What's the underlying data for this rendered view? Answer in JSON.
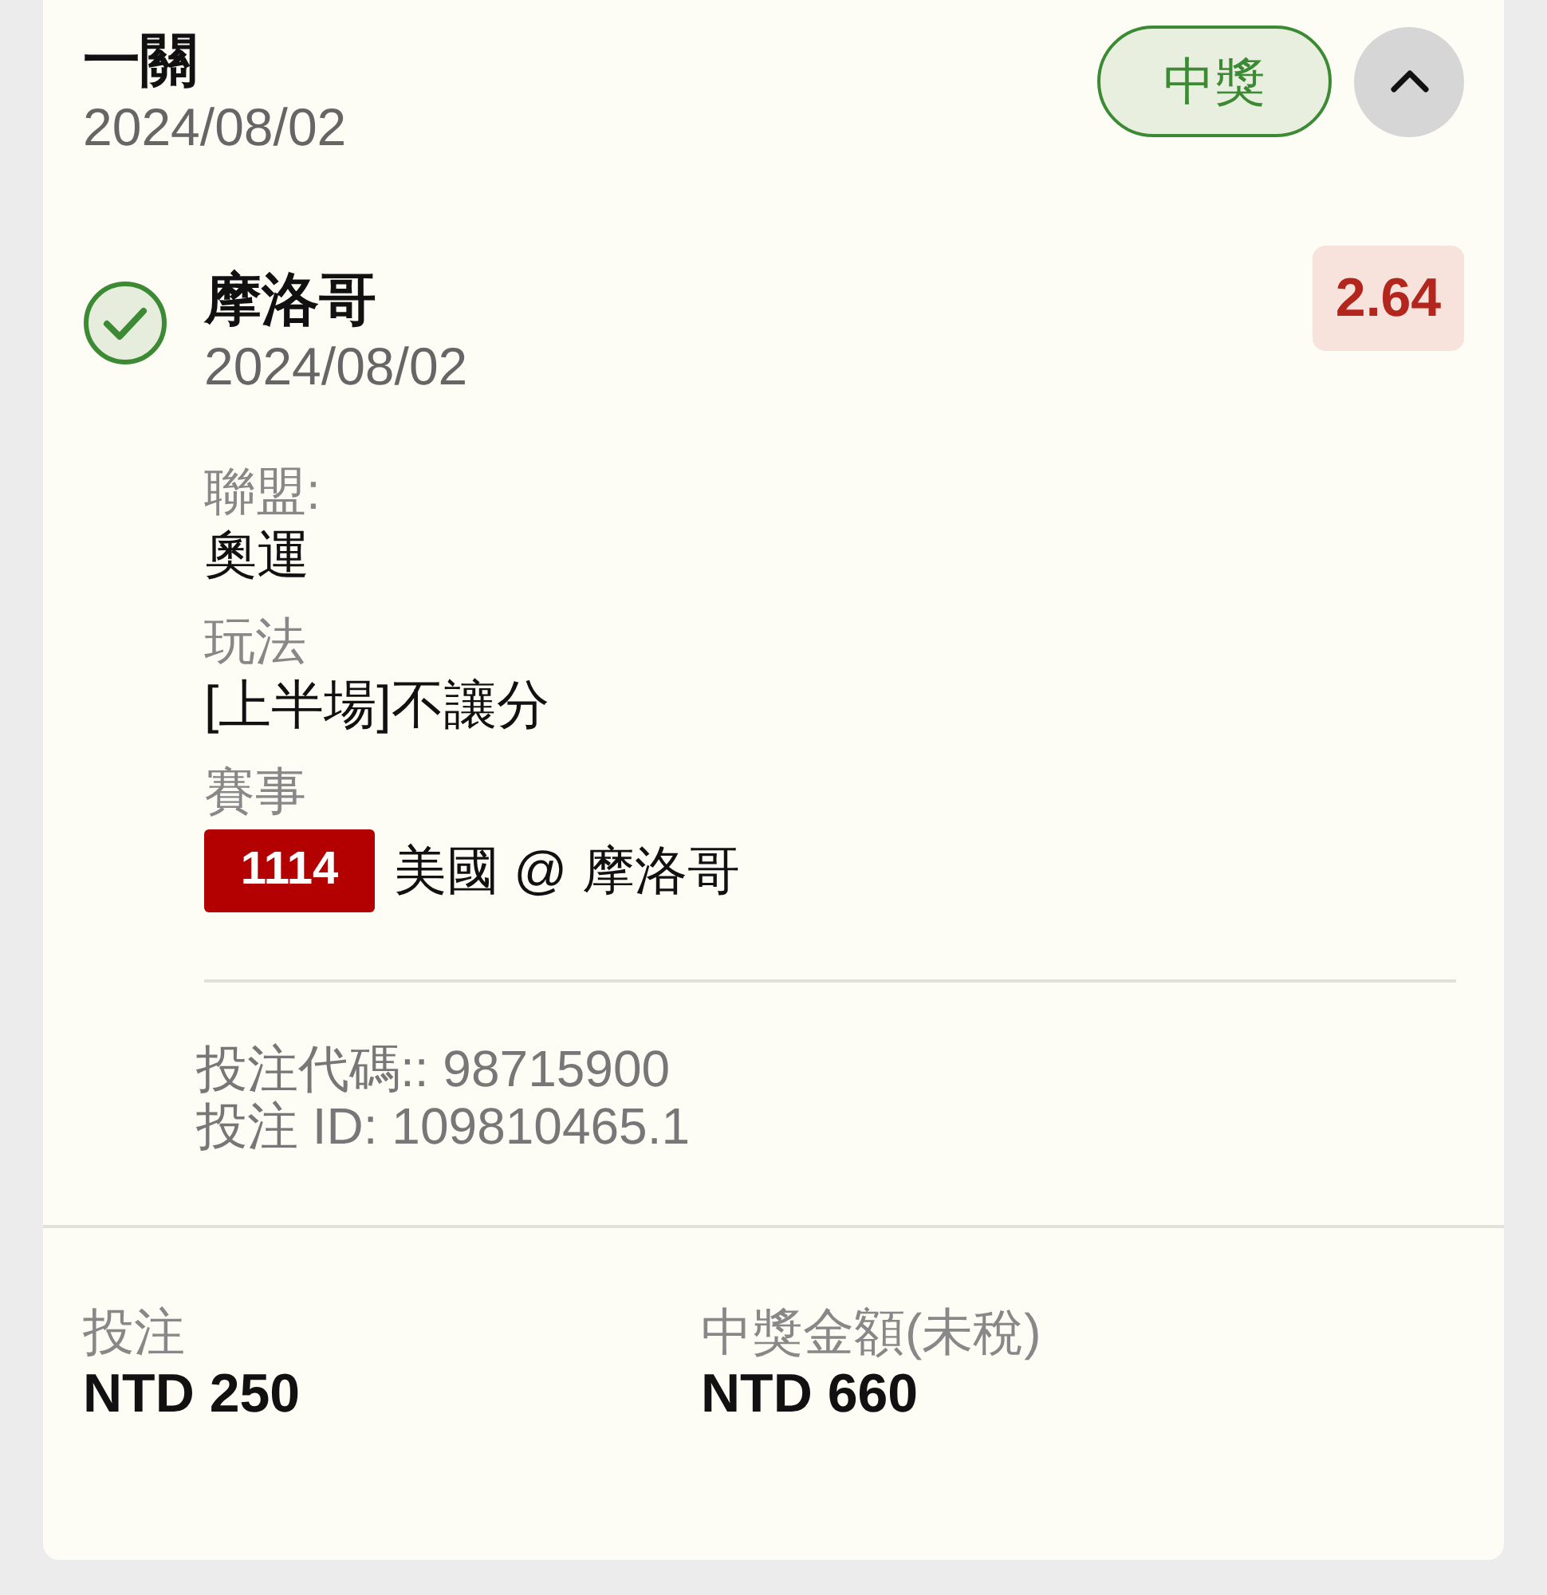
{
  "bet": {
    "type": "一關",
    "date": "2024/08/02",
    "status": {
      "label": "中獎",
      "won": true
    },
    "expanded": true
  },
  "selection": {
    "won": true,
    "team": "摩洛哥",
    "date": "2024/08/02",
    "odds": "2.64",
    "fields": [
      {
        "kind": "text",
        "label": "聯盟:",
        "value": "奧運"
      },
      {
        "kind": "text",
        "label": "玩法",
        "value": "[上半場]不讓分"
      },
      {
        "kind": "match",
        "label": "賽事",
        "code": "1114",
        "value": "美國 @ 摩洛哥"
      }
    ]
  },
  "codes": [
    "投注代碼:: 98715900",
    "投注 ID: 109810465.1"
  ],
  "summary": [
    {
      "label": "投注",
      "value": "NTD 250"
    },
    {
      "label": "中獎金額(未稅)",
      "value": "NTD 660"
    }
  ]
}
